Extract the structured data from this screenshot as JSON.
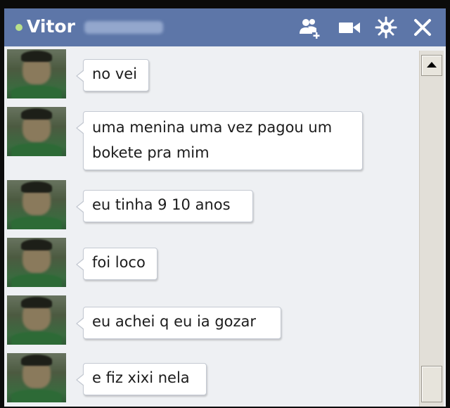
{
  "chat": {
    "contact_name": "Vitor",
    "status_color": "#b9e08a",
    "header_icons": [
      "add-friends-icon",
      "video-call-icon",
      "settings-gear-icon",
      "close-icon"
    ],
    "colors": {
      "header": "#5d76a8",
      "background": "#eef0f3",
      "bubble": "#ffffff"
    }
  },
  "messages": [
    {
      "text": "no vei"
    },
    {
      "text": "uma menina uma vez pagou um\nbokete pra mim"
    },
    {
      "text": "eu tinha 9 10 anos"
    },
    {
      "text": "foi loco"
    },
    {
      "text": "eu achei q eu ia gozar"
    },
    {
      "text": "e fiz xixi nela"
    }
  ]
}
